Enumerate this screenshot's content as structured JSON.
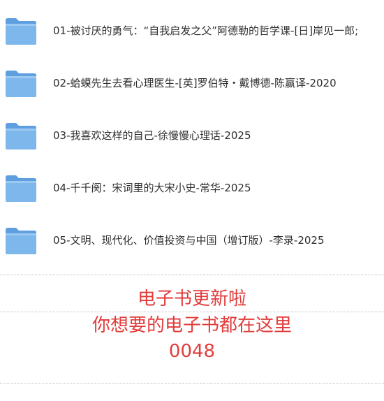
{
  "files": [
    {
      "name": "01-被讨厌的勇气：“自我启发之父”阿德勒的哲学课-[日]岸见一郎;",
      "icon": "folder-icon"
    },
    {
      "name": "02-蛤蟆先生去看心理医生-[英]罗伯特・戴博德-陈赢译-2020",
      "icon": "folder-icon"
    },
    {
      "name": "03-我喜欢这样的自己-徐慢慢心理话-2025",
      "icon": "folder-icon"
    },
    {
      "name": "04-千千阕：宋词里的大宋小史-常华-2025",
      "icon": "folder-icon"
    },
    {
      "name": "05-文明、现代化、价值投资与中国（增订版）-李录-2025",
      "icon": "folder-icon"
    }
  ],
  "notice": {
    "line1": "电子书更新啦",
    "line2": "你想要的电子书都在这里",
    "line3": "0048"
  },
  "footer": {
    "text": "",
    "link": ""
  },
  "colors": {
    "notice": "#e23b3b",
    "folder_body": "#7db7ec",
    "folder_tab": "#5f9fe0"
  }
}
